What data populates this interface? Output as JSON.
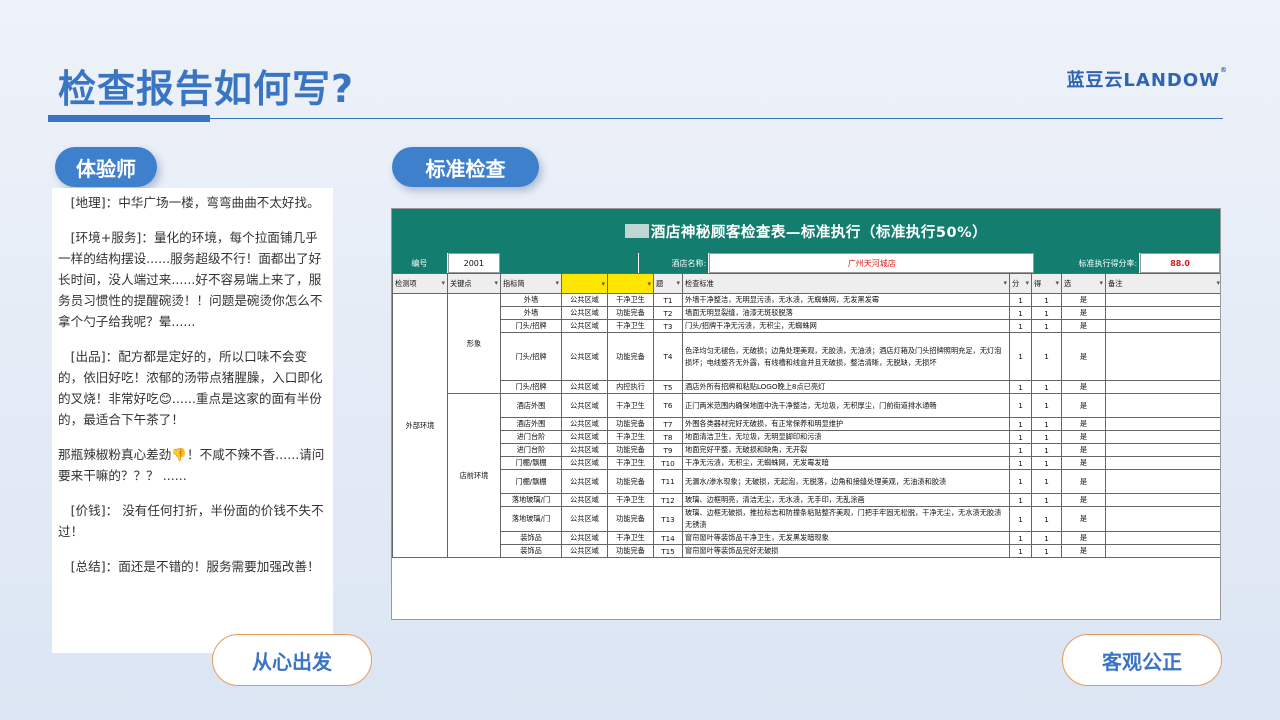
{
  "header": {
    "title": "检查报告如何写?",
    "brand": "蓝豆云LANDOW",
    "brand_mark": "®"
  },
  "left": {
    "tag": "体验师",
    "footer_button": "从心出发",
    "review": [
      "[地理]：中华广场一楼，弯弯曲曲不太好找。",
      "[环境+服务]：量化的环境，每个拉面铺几乎一样的结构摆设......服务超级不行！面都出了好长时间，没人端过来......好不容易端上来了，服务员习惯性的提醒碗烫！！问题是碗烫你怎么不拿个勺子给我呢？晕......",
      "[出品]：配方都是定好的，所以口味不会变的，依旧好吃！浓郁的汤带点猪腥臊，入口即化的叉烧！非常好吃😊......重点是这家的面有半份的，最适合下午茶了！",
      "那瓶辣椒粉真心差劲👎！不咸不辣不香......请问要来干嘛的？？？ ......",
      "[价钱]： 没有任何打折，半份面的价钱不失不过！",
      "[总结]：面还是不错的！服务需要加强改善！"
    ]
  },
  "right": {
    "tag": "标准检查",
    "footer_button": "客观公正",
    "sheet": {
      "title": "酒店神秘顾客检查表—标准执行（标准执行50%）",
      "info": {
        "no_label": "编号",
        "no_value": "2001",
        "hotel_label": "酒店名称:",
        "hotel_value": "广州天河城店",
        "score_label": "标准执行得分率:",
        "score_value": "88.0"
      },
      "columns": [
        "检测项",
        "关键点",
        "指标简",
        "",
        "",
        "题",
        "检查标准",
        "分",
        "得",
        "选",
        "备注"
      ],
      "rows": [
        {
          "area": "外部环境",
          "key": "形象",
          "item": "外墙",
          "zone": "公共区域",
          "type": "干净卫生",
          "id": "T1",
          "std": "外墙干净整洁，无明显污渍，无水渍，无蜘蛛网，无发黑发霉",
          "a": "1",
          "b": "1",
          "sel": "是"
        },
        {
          "area": "",
          "key": "",
          "item": "外墙",
          "zone": "公共区域",
          "type": "功能完备",
          "id": "T2",
          "std": "墙面无明显裂缝，油漆无斑驳脱落",
          "a": "1",
          "b": "1",
          "sel": "是"
        },
        {
          "area": "",
          "key": "",
          "item": "门头/招牌",
          "zone": "公共区域",
          "type": "干净卫生",
          "id": "T3",
          "std": "门头/招牌干净无污渍，无积尘，无蜘蛛网",
          "a": "1",
          "b": "1",
          "sel": "是"
        },
        {
          "area": "",
          "key": "",
          "item": "门头/招牌",
          "zone": "公共区域",
          "type": "功能完备",
          "id": "T4",
          "std": "色泽均匀无褪色，无破损；边角处理美观，无胶渍，无油渍；酒店灯箱及门头招牌照明充足，无灯泡损坏；电线整齐无外露，有线槽和线盒并且无破损，整洁清晰，无脱缺，无损坏",
          "a": "1",
          "b": "1",
          "sel": "是"
        },
        {
          "area": "",
          "key": "",
          "item": "门头/招牌",
          "zone": "公共区域",
          "type": "内控执行",
          "id": "T5",
          "std": "酒店外所有招牌和粘贴LOGO晚上8点已亮灯",
          "a": "1",
          "b": "1",
          "sel": "是"
        },
        {
          "area": "",
          "key": "店前环境",
          "item": "酒店外围",
          "zone": "公共区域",
          "type": "干净卫生",
          "id": "T6",
          "std": "正门两米范围内确保地面中洗干净整洁，无垃圾，无积厚尘，门前街道排水通畅",
          "a": "1",
          "b": "1",
          "sel": "是"
        },
        {
          "area": "",
          "key": "",
          "item": "酒店外围",
          "zone": "公共区域",
          "type": "功能完备",
          "id": "T7",
          "std": "外围各类器材完好无破损，有正常保养和明显维护",
          "a": "1",
          "b": "1",
          "sel": "是"
        },
        {
          "area": "",
          "key": "",
          "item": "进门台阶",
          "zone": "公共区域",
          "type": "干净卫生",
          "id": "T8",
          "std": "地面清洁卫生，无垃圾，无明显脚印和污渍",
          "a": "1",
          "b": "1",
          "sel": "是"
        },
        {
          "area": "",
          "key": "",
          "item": "进门台阶",
          "zone": "公共区域",
          "type": "功能完备",
          "id": "T9",
          "std": "地面完好平整，无破损和缺角，无开裂",
          "a": "1",
          "b": "1",
          "sel": "是"
        },
        {
          "area": "",
          "key": "",
          "item": "门棚/飘棚",
          "zone": "公共区域",
          "type": "干净卫生",
          "id": "T10",
          "std": "干净无污渍，无积尘，无蜘蛛网，无发霉发暗",
          "a": "1",
          "b": "1",
          "sel": "是"
        },
        {
          "area": "",
          "key": "",
          "item": "门棚/飘棚",
          "zone": "公共区域",
          "type": "功能完备",
          "id": "T11",
          "std": "无漏水/渗水现象；无破损，无起泡，无脱落，边角和接缝处理美观，无油渍和胶渍",
          "a": "1",
          "b": "1",
          "sel": "是"
        },
        {
          "area": "",
          "key": "",
          "item": "落地玻璃/门",
          "zone": "公共区域",
          "type": "干净卫生",
          "id": "T12",
          "std": "玻璃、边框明亮，清洁无尘，无水渍，无手印，无乱涂画",
          "a": "1",
          "b": "1",
          "sel": "是"
        },
        {
          "area": "",
          "key": "",
          "item": "落地玻璃/门",
          "zone": "公共区域",
          "type": "功能完备",
          "id": "T13",
          "std": "玻璃、边框无破损，推拉标志和防撞条粘贴整齐美观，门把手牢固无松脱，干净无尘，无水渍无胶渍无锈渍",
          "a": "1",
          "b": "1",
          "sel": "是"
        },
        {
          "area": "",
          "key": "",
          "item": "装饰品",
          "zone": "公共区域",
          "type": "干净卫生",
          "id": "T14",
          "std": "窗帘窗叶等装饰品干净卫生，无发黑发暗现象",
          "a": "1",
          "b": "1",
          "sel": "是"
        },
        {
          "area": "",
          "key": "",
          "item": "装饰品",
          "zone": "公共区域",
          "type": "功能完备",
          "id": "T15",
          "std": "窗帘窗叶等装饰品完好无破损",
          "a": "1",
          "b": "1",
          "sel": "是"
        }
      ]
    }
  },
  "colors": {
    "accent": "#3a75c4",
    "sheet_header": "#137d6f",
    "outline": "#e69a5c",
    "score_red": "#d41c1c"
  }
}
